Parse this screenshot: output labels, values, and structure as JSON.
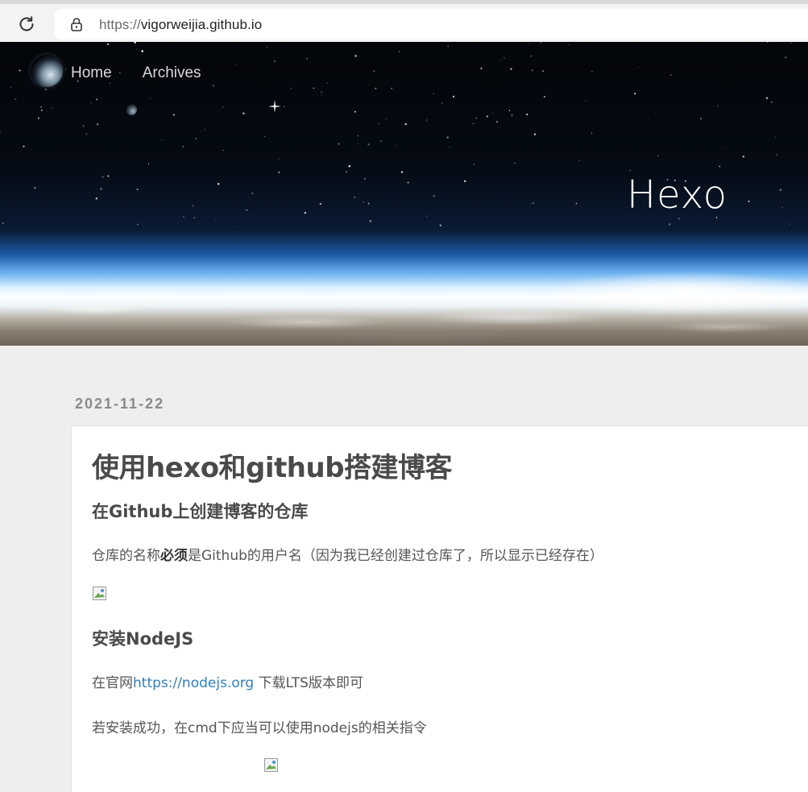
{
  "browser": {
    "url_scheme": "https://",
    "url_host": "vigorweijia.github.io",
    "reload_icon": "reload-icon",
    "lock_icon": "lock-icon"
  },
  "header": {
    "nav": [
      "Home",
      "Archives"
    ],
    "site_title": "Hexo"
  },
  "post": {
    "date": "2021-11-22",
    "title": "使用hexo和github搭建博客",
    "sections": [
      {
        "heading": "在Github上创建博客的仓库",
        "para_before": "仓库的名称",
        "para_bold": "必须",
        "para_after": "是Github的用户名（因为我已经创建过仓库了，所以显示已经存在）"
      },
      {
        "heading": "安装NodeJS",
        "para1_before": "在官网",
        "para1_link": "https://nodejs.org",
        "para1_after": " 下载LTS版本即可",
        "para2": "若安装成功，在cmd下应当可以使用nodejs的相关指令"
      }
    ]
  },
  "colors": {
    "page_bg": "#eeeeee",
    "card_bg": "#ffffff",
    "link": "#2f7fbd",
    "heading": "#4a4a4a"
  }
}
